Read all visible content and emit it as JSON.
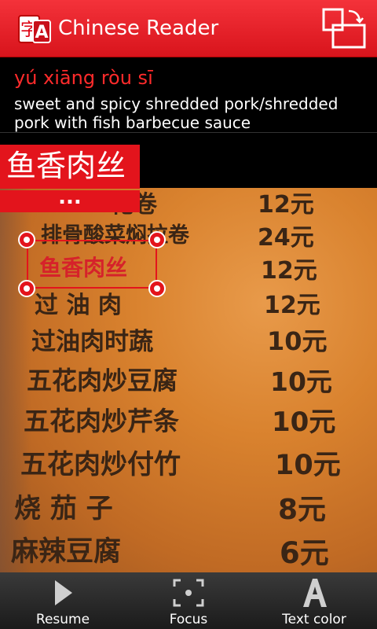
{
  "app": {
    "title": "Chinese Reader"
  },
  "translation": {
    "pinyin": "yú xiāng ròu sī",
    "meaning": "sweet and spicy shredded pork/shredded pork with fish barbecue sauce"
  },
  "detected": {
    "text": "鱼香肉丝",
    "more": "..."
  },
  "menu": [
    {
      "name": "花卷",
      "price": "12元"
    },
    {
      "name": "排骨酸菜焖拉卷",
      "price": "24元"
    },
    {
      "name": "鱼香肉丝",
      "price": "12元"
    },
    {
      "name": "过  油  肉",
      "price": "12元"
    },
    {
      "name": "过油肉时蔬",
      "price": "10元"
    },
    {
      "name": "五花肉炒豆腐",
      "price": "10元"
    },
    {
      "name": "五花肉炒芹条",
      "price": "10元"
    },
    {
      "name": "五花肉炒付竹",
      "price": "10元"
    },
    {
      "name": "烧  茄  子",
      "price": "8元"
    },
    {
      "name": "麻辣豆腐",
      "price": "6元"
    }
  ],
  "toolbar": {
    "resume": "Resume",
    "focus": "Focus",
    "text_color": "Text color"
  },
  "colors": {
    "accent": "#e3141c",
    "toolbar": "#2a2a2a"
  },
  "icons": [
    "app-logo-icon",
    "rotate-screen-icon",
    "play-icon",
    "focus-icon",
    "text-color-icon"
  ]
}
